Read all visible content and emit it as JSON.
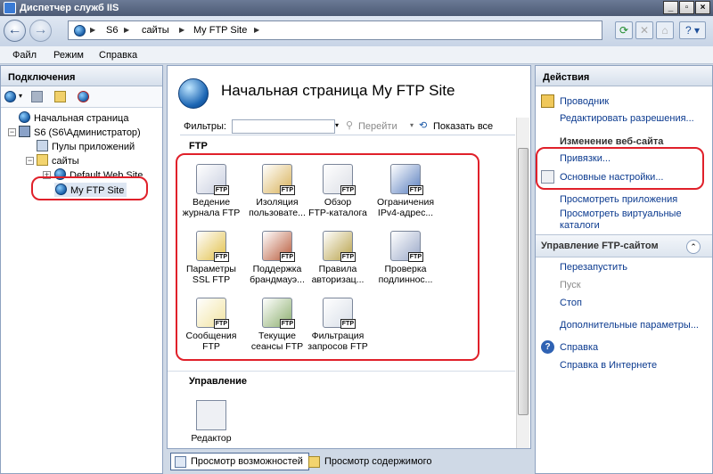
{
  "window": {
    "title": "Диспетчер служб IIS"
  },
  "address": {
    "crumbs": [
      "S6",
      "сайты",
      "My FTP Site"
    ]
  },
  "menu": {
    "items": [
      "Файл",
      "Режим",
      "Справка"
    ]
  },
  "connections": {
    "header": "Подключения",
    "tree": [
      "Начальная страница",
      "S6 (S6\\Администратор)",
      "Пулы приложений",
      "сайты",
      "Default Web Site",
      "My FTP Site"
    ]
  },
  "center": {
    "title": "Начальная страница My FTP Site",
    "filter_label": "Фильтры:",
    "go_label": "Перейти",
    "show_all_label": "Показать все",
    "section_ftp": "FTP",
    "section_manage": "Управление",
    "features": [
      {
        "l1": "Ведение",
        "l2": "журнала FTP"
      },
      {
        "l1": "Изоляция",
        "l2": "пользовате..."
      },
      {
        "l1": "Обзор",
        "l2": "FTP-каталога"
      },
      {
        "l1": "Ограничения",
        "l2": "IPv4-адрес..."
      },
      {
        "l1": "Параметры",
        "l2": "SSL FTP"
      },
      {
        "l1": "Поддержка",
        "l2": "брандмауэ..."
      },
      {
        "l1": "Правила",
        "l2": "авторизац..."
      },
      {
        "l1": "Проверка",
        "l2": "подлиннос..."
      },
      {
        "l1": "Сообщения",
        "l2": "FTP"
      },
      {
        "l1": "Текущие",
        "l2": "сеансы FTP"
      },
      {
        "l1": "Фильтрация",
        "l2": "запросов FTP"
      }
    ],
    "manage_item": "Редактор",
    "badge": "FTP"
  },
  "bottom_tabs": {
    "features_view": "Просмотр возможностей",
    "content_view": "Просмотр содержимого"
  },
  "actions": {
    "header": "Действия",
    "explorer": "Проводник",
    "edit_permissions": "Редактировать разрешения...",
    "edit_site_header": "Изменение веб-сайта",
    "bindings": "Привязки...",
    "basic_settings": "Основные настройки...",
    "view_apps": "Просмотреть приложения",
    "view_vdirs_1": "Просмотреть виртуальные",
    "view_vdirs_2": "каталоги",
    "manage_ftp_header": "Управление FTP-сайтом",
    "restart": "Перезапустить",
    "start": "Пуск",
    "stop": "Стоп",
    "advanced": "Дополнительные параметры...",
    "help": "Справка",
    "help_online": "Справка в Интернете"
  },
  "colors": {
    "accent_ring": "#e0202a",
    "link": "#0b3a8f"
  }
}
